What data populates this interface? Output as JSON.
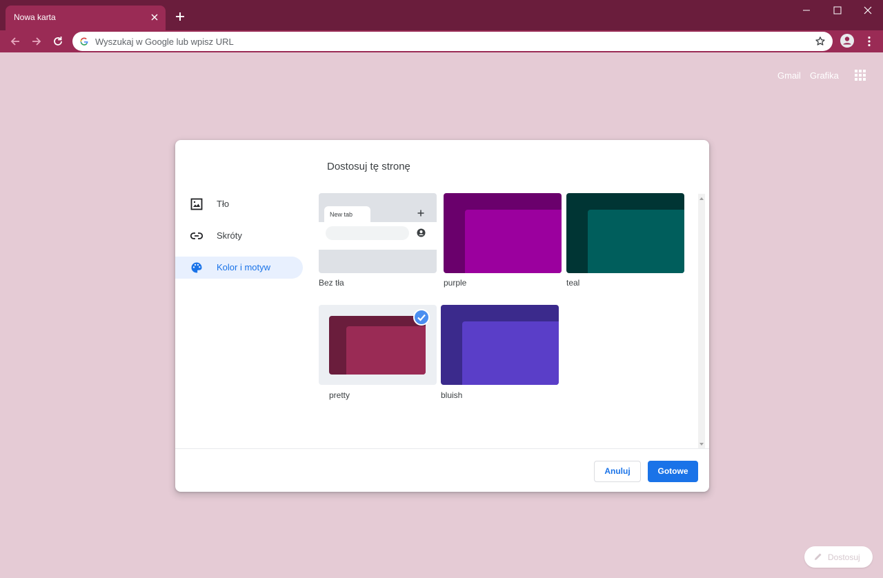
{
  "browser": {
    "tab_title": "Nowa karta",
    "omnibox_placeholder": "Wyszukaj w Google lub wpisz URL",
    "colors": {
      "frame": "#6a1d3c",
      "tab": "#9a2b55",
      "page_bg": "#e5cbd5"
    }
  },
  "ntp": {
    "links": [
      "Gmail",
      "Grafika"
    ],
    "customize_label": "Dostosuj"
  },
  "dialog": {
    "title": "Dostosuj tę stronę",
    "menu": [
      {
        "label": "Tło",
        "icon": "image-icon",
        "selected": false
      },
      {
        "label": "Skróty",
        "icon": "link-icon",
        "selected": false
      },
      {
        "label": "Kolor i motyw",
        "icon": "palette-icon",
        "selected": true
      }
    ],
    "preview": {
      "tab_label": "New tab"
    },
    "themes": [
      {
        "label": "Bez tła",
        "selected": false
      },
      {
        "label": "purple",
        "outer": "#6a006c",
        "inner": "#9b009e",
        "selected": false
      },
      {
        "label": "teal",
        "outer": "#003534",
        "inner": "#005e5c",
        "selected": false
      },
      {
        "label": "pretty",
        "outer": "#6a1d3c",
        "inner": "#9a2b55",
        "selected": true
      },
      {
        "label": "bluish",
        "outer": "#3b2a8c",
        "inner": "#5a3ec8",
        "selected": false
      }
    ],
    "buttons": {
      "cancel": "Anuluj",
      "done": "Gotowe"
    }
  }
}
